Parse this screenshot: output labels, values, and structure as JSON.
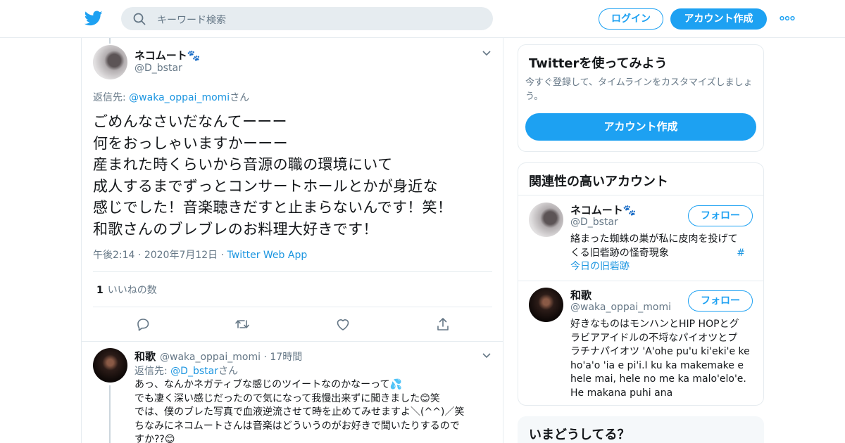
{
  "header": {
    "search_placeholder": "キーワード検索",
    "login_label": "ログイン",
    "signup_label": "アカウント作成"
  },
  "main_tweet": {
    "display_name": "ネコムート🐾",
    "handle": "@D_bstar",
    "reply_prefix": "返信先: ",
    "reply_handle": "@waka_oppai_momi",
    "reply_suffix": "さん",
    "lines": [
      "ごめんなさいだなんてーーー",
      "何をおっしゃいますかーーー",
      "産まれた時くらいから音源の職の環境にいて",
      "成人するまでずっとコンサートホールとかが身近な",
      "感じでした！音楽聴きだすと止まらないんです！笑！",
      "和歌さんのブレブレのお料理大好きです！"
    ],
    "time": "午後2:14",
    "date": "2020年7月12日",
    "app": "Twitter Web App",
    "like_count": "1",
    "like_label": "いいねの数"
  },
  "reply_tweet": {
    "display_name": "和歌",
    "handle": "@waka_oppai_momi",
    "age": "17時間",
    "reply_prefix": "返信先: ",
    "reply_handle": "@D_bstar",
    "reply_suffix": "さん",
    "lines": [
      "あっ、なんかネガティブな感じのツイートなのかなーって💦",
      "でも凄く深い感じだったので気になって我慢出来ずに聞きました😊笑",
      "では、僕のブレた写真で血液逆流させて時を止めてみせますよ＼(^^)／笑",
      "ちなみにネコムートさんは音楽はどういうのがお好きで聞いたりするので",
      "すか??😊"
    ]
  },
  "sidebar": {
    "try_card": {
      "title": "Twitterを使ってみよう",
      "subtitle": "今すぐ登録して、タイムラインをカスタマイズしましょう。",
      "button_label": "アカウント作成"
    },
    "related": {
      "title": "関連性の高いアカウント",
      "follow_label": "フォロー",
      "accounts": [
        {
          "name": "ネコムート🐾",
          "handle": "@D_bstar",
          "bio_lines": [
            "絡まった蜘蛛の巣が私に皮肉を投げて",
            "くる旧砦跡の怪奇現象"
          ],
          "hashtag_mark": "#",
          "hashtag_text": "今日の旧砦跡"
        },
        {
          "name": "和歌",
          "handle": "@waka_oppai_momi",
          "bio_lines": [
            "好きなものはモンハンとHIP HOPとグ",
            "ラビアアイドルの不埒なパイオツとプ",
            "ラチナパイオツ 'A'ohe pu'u ki'eki'e ke",
            "ho'a'o 'ia e pi'i.I ku ka makemake e",
            "hele mai, hele no me ka malo'elo'e.",
            "He makana puhi ana"
          ]
        }
      ]
    },
    "whats_happening": {
      "title": "いまどうしてる？"
    }
  },
  "colors": {
    "accent": "#1da1f2",
    "link": "#1b95e0",
    "muted": "#657786",
    "border": "#e6ecf0"
  }
}
